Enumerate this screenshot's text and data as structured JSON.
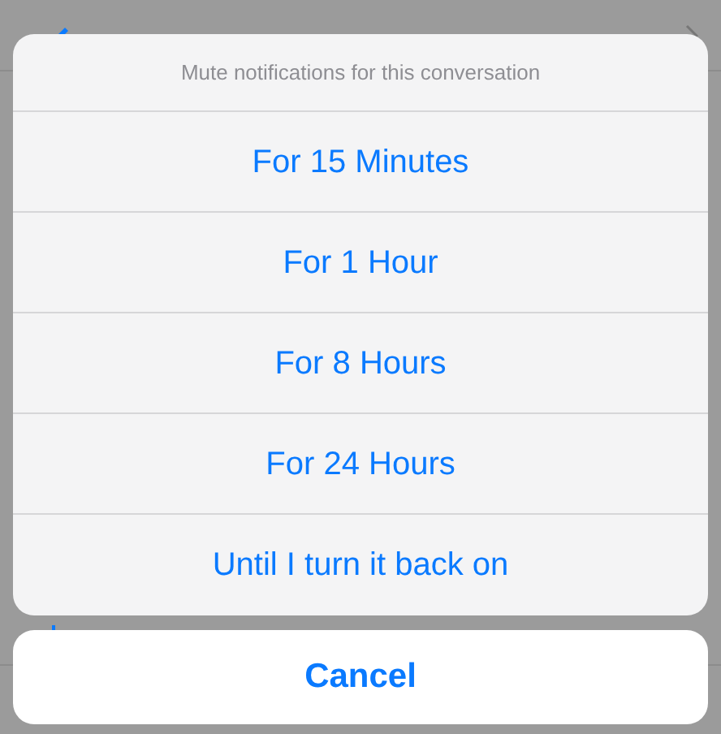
{
  "background_list": [
    {
      "kind": "pencil"
    },
    {
      "kind": "bar"
    }
  ],
  "action_sheet": {
    "title": "Mute notifications for this conversation",
    "options": [
      "For 15 Minutes",
      "For 1 Hour",
      "For 8 Hours",
      "For 24 Hours",
      "Until I turn it back on"
    ],
    "cancel": "Cancel"
  }
}
